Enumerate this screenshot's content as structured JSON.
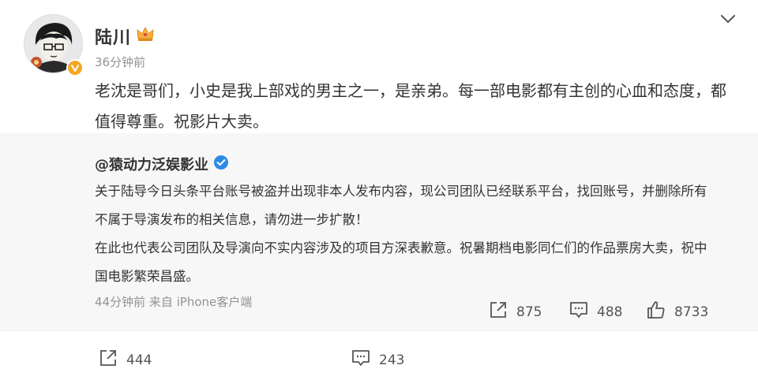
{
  "post": {
    "username": "陆川",
    "timestamp": "36分钟前",
    "text": "老沈是哥们，小史是我上部戏的男主之一，是亲弟。每一部电影都有主创的心血和态度，都值得尊重。祝影片大卖。",
    "share_count": "444",
    "comment_count": "243"
  },
  "repost": {
    "author": "@猿动力泛娱影业",
    "paragraph1": "关于陆导今日头条平台账号被盗并出现非本人发布内容，现公司团队已经联系平台，找回账号，并删除所有不属于导演发布的相关信息，请勿进一步扩散！",
    "paragraph2": "在此也代表公司团队及导演向不实内容涉及的项目方深表歉意。祝暑期档电影同仁们的作品票房大卖，祝中国电影繁荣昌盛。",
    "meta": "44分钟前 来自 iPhone客户端",
    "share_count": "875",
    "comment_count": "488",
    "like_count": "8733"
  },
  "icons": {
    "menu": "chevron-down-icon",
    "vip": "crown-icon",
    "verified": "verified-icon",
    "share": "share-icon",
    "comment": "comment-icon",
    "like": "like-icon"
  },
  "colors": {
    "verified_gold": "#f5a623",
    "verified_blue": "#2b8be6",
    "meta_gray": "#939393",
    "repost_bg": "#f7f7f7"
  }
}
